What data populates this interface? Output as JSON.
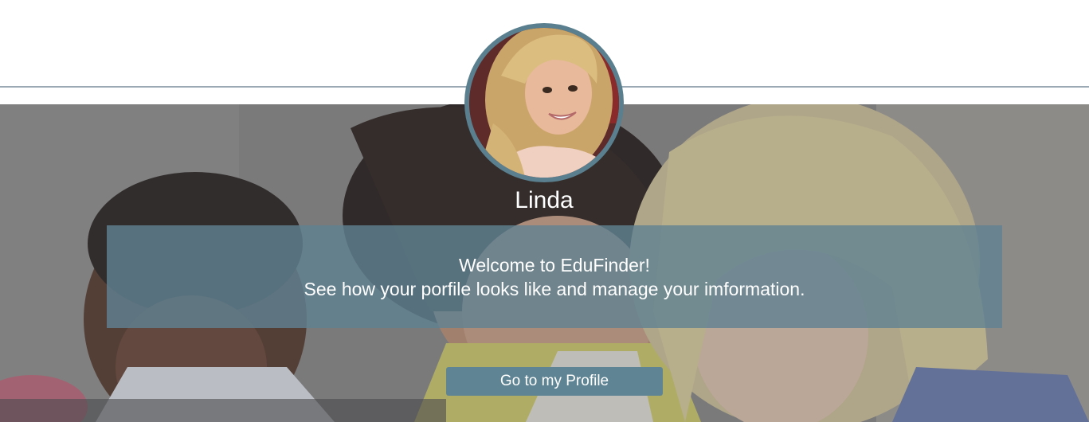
{
  "user": {
    "name": "Linda"
  },
  "welcome": {
    "line1": "Welcome to EduFinder!",
    "line2": "See how your porfile looks like and manage your imformation."
  },
  "actions": {
    "profile_button_label": "Go to my Profile"
  },
  "colors": {
    "accent": "#5f8493",
    "panel": "#6082922c",
    "avatar_ring": "#5a7f8e",
    "divider": "#9aa9b3"
  },
  "icons": {
    "avatar": "user-photo",
    "hero": "students-photo"
  }
}
